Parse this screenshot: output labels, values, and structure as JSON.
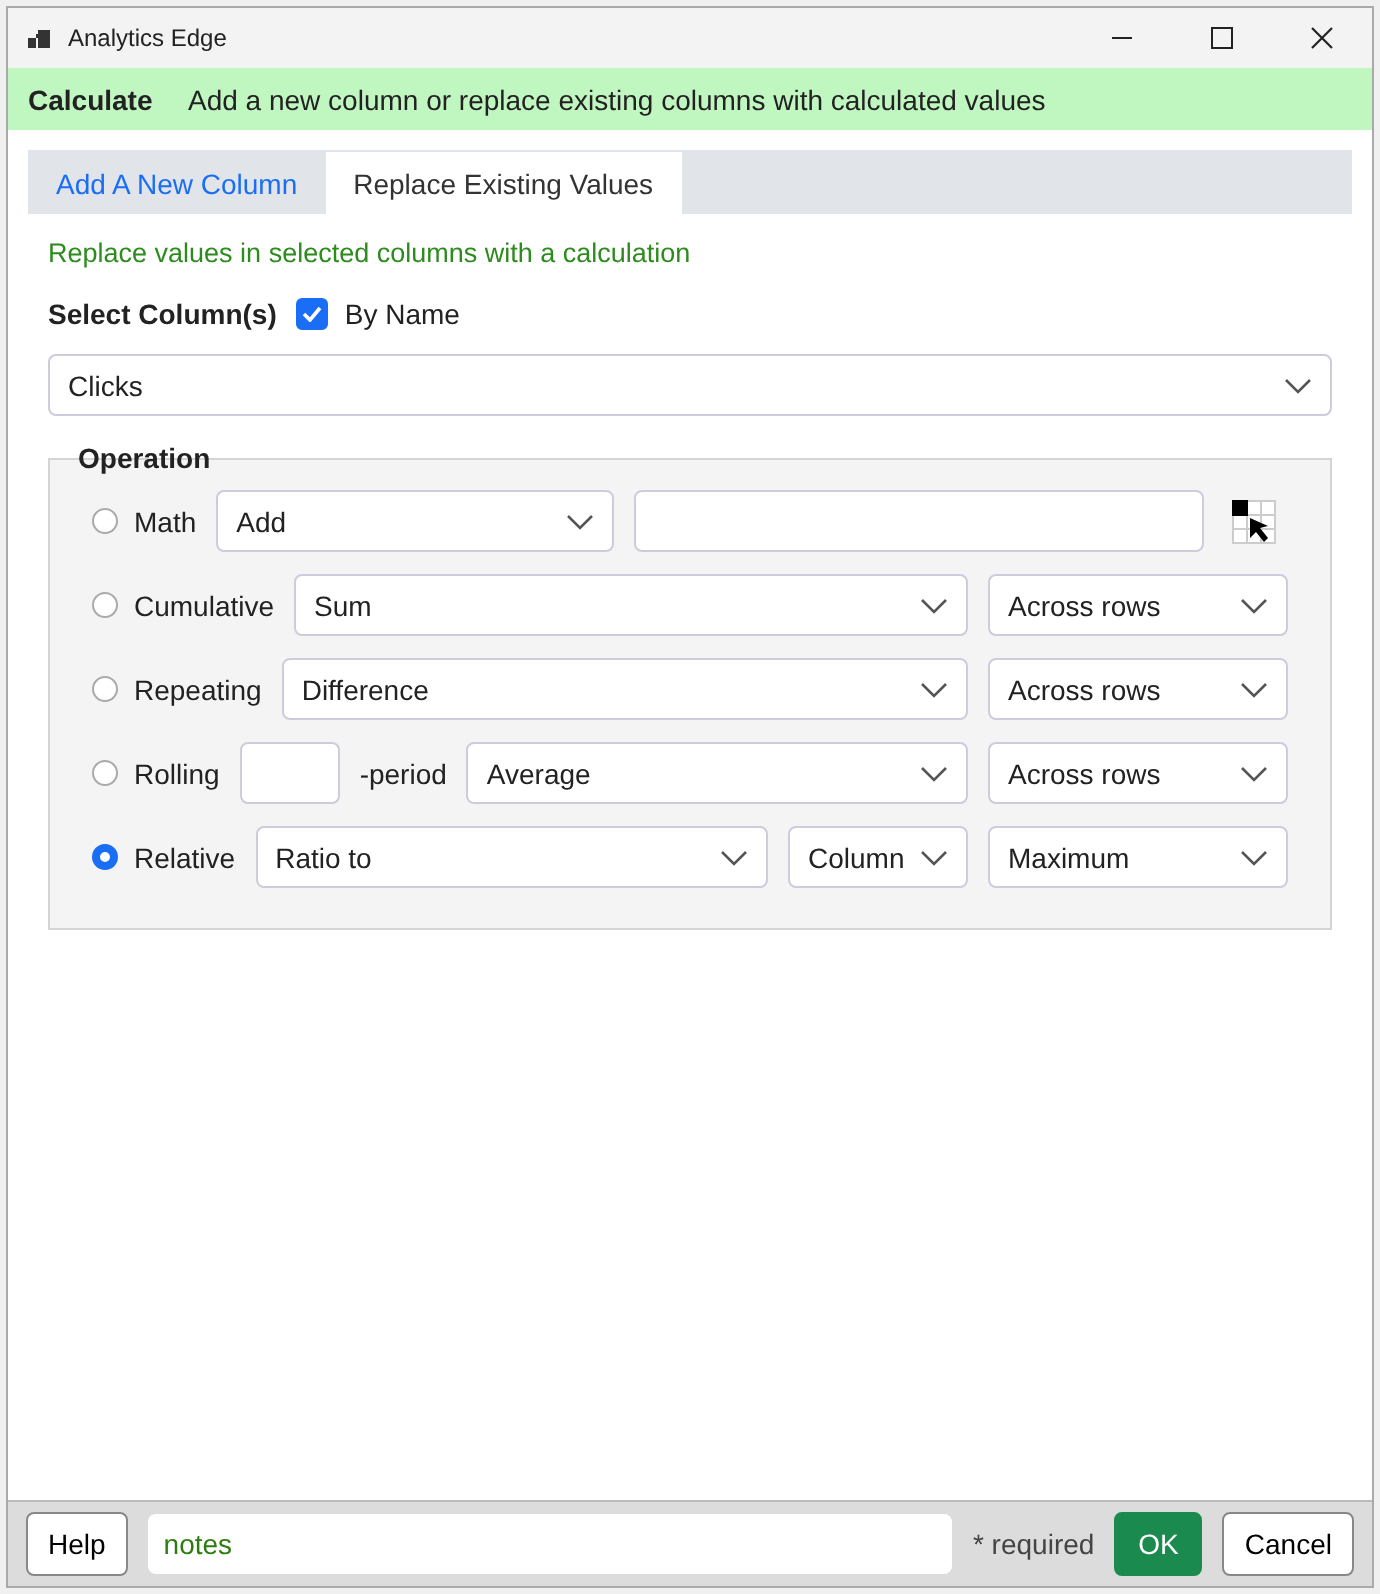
{
  "window": {
    "title": "Analytics Edge"
  },
  "banner": {
    "title": "Calculate",
    "description": "Add a new column or replace existing columns with calculated values"
  },
  "tabs": [
    {
      "label": "Add A New Column",
      "selected": false
    },
    {
      "label": "Replace Existing Values",
      "selected": true
    }
  ],
  "hint": "Replace values in selected columns with a calculation",
  "select_columns": {
    "label": "Select Column(s)",
    "by_name": {
      "label": "By Name",
      "checked": true
    },
    "value": "Clicks"
  },
  "operation": {
    "title": "Operation",
    "rows": [
      {
        "label": "Math",
        "selected": false,
        "controls": [
          {
            "kind": "select",
            "value": "Add"
          },
          {
            "kind": "input"
          },
          {
            "kind": "picker"
          }
        ]
      },
      {
        "label": "Cumulative",
        "selected": false,
        "controls": [
          {
            "kind": "select",
            "value": "Sum"
          },
          {
            "kind": "select",
            "value": "Across rows"
          }
        ]
      },
      {
        "label": "Repeating",
        "selected": false,
        "controls": [
          {
            "kind": "select",
            "value": "Difference"
          },
          {
            "kind": "select",
            "value": "Across rows"
          }
        ]
      },
      {
        "label": "Rolling",
        "selected": false,
        "controls": [
          {
            "kind": "input"
          },
          {
            "kind": "text",
            "text": "-period"
          },
          {
            "kind": "select",
            "value": "Average"
          },
          {
            "kind": "select",
            "value": "Across rows"
          }
        ]
      },
      {
        "label": "Relative",
        "selected": true,
        "controls": [
          {
            "kind": "select",
            "value": "Ratio to"
          },
          {
            "kind": "select",
            "value": "Column"
          },
          {
            "kind": "select",
            "value": "Maximum"
          }
        ]
      }
    ]
  },
  "footer": {
    "help": "Help",
    "notes": "notes",
    "required": "* required",
    "ok": "OK",
    "cancel": "Cancel"
  }
}
